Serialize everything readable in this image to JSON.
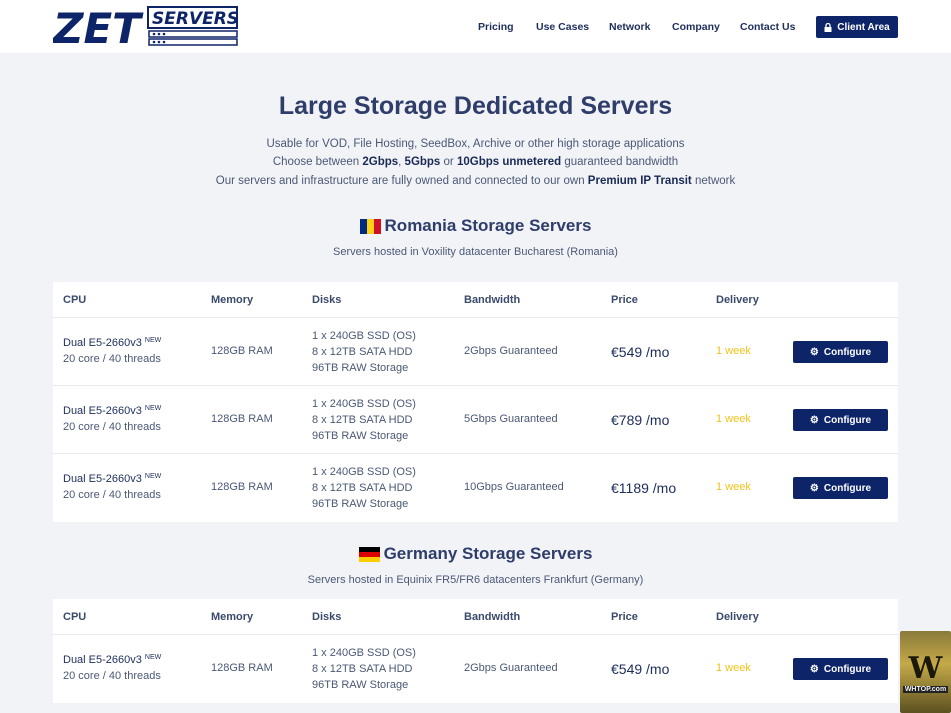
{
  "brand": {
    "name_main": "ZET",
    "name_sub": "SERVERS",
    "primary_color": "#0e2469",
    "accent_yellow": "#f0c419"
  },
  "nav": {
    "items": [
      "Pricing",
      "Use Cases",
      "Network",
      "Company",
      "Contact Us"
    ],
    "client_area": "Client Area"
  },
  "hero": {
    "title": "Large Storage Dedicated Servers",
    "line1": "Usable for VOD, File Hosting, SeedBox, Archive or other high storage applications",
    "line2_pre": "Choose between ",
    "line2_b1": "2Gbps",
    "line2_sep1": ", ",
    "line2_b2": "5Gbps",
    "line2_sep2": " or ",
    "line2_b3": "10Gbps unmetered",
    "line2_post": " guaranteed bandwidth",
    "line3_pre": "Our servers and infrastructure are fully owned and connected to our own ",
    "line3_b": "Premium IP Transit",
    "line3_post": " network"
  },
  "headers": {
    "cpu": "CPU",
    "memory": "Memory",
    "disks": "Disks",
    "bandwidth": "Bandwidth",
    "price": "Price",
    "delivery": "Delivery"
  },
  "sections": [
    {
      "title": "Romania Storage Servers",
      "subtitle": "Servers hosted in Voxility datacenter Bucharest (Romania)",
      "rows": [
        {
          "cpu": "Dual E5-2660v3",
          "tag": "NEW",
          "cores": "20 core / 40 threads",
          "memory": "128GB RAM",
          "disk1": "1 x 240GB SSD (OS)",
          "disk2": "8 x 12TB SATA HDD",
          "disk3": "96TB RAW Storage",
          "bandwidth": "2Gbps Guaranteed",
          "price": "€549 /mo",
          "delivery": "1 week",
          "button": "Configure"
        },
        {
          "cpu": "Dual E5-2660v3",
          "tag": "NEW",
          "cores": "20 core / 40 threads",
          "memory": "128GB RAM",
          "disk1": "1 x 240GB SSD (OS)",
          "disk2": "8 x 12TB SATA HDD",
          "disk3": "96TB RAW Storage",
          "bandwidth": "5Gbps Guaranteed",
          "price": "€789 /mo",
          "delivery": "1 week",
          "button": "Configure"
        },
        {
          "cpu": "Dual E5-2660v3",
          "tag": "NEW",
          "cores": "20 core / 40 threads",
          "memory": "128GB RAM",
          "disk1": "1 x 240GB SSD (OS)",
          "disk2": "8 x 12TB SATA HDD",
          "disk3": "96TB RAW Storage",
          "bandwidth": "10Gbps Guaranteed",
          "price": "€1189 /mo",
          "delivery": "1 week",
          "button": "Configure"
        }
      ]
    },
    {
      "title": "Germany Storage Servers",
      "subtitle": "Servers hosted in Equinix FR5/FR6 datacenters Frankfurt (Germany)",
      "rows": [
        {
          "cpu": "Dual E5-2660v3",
          "tag": "NEW",
          "cores": "20 core / 40 threads",
          "memory": "128GB RAM",
          "disk1": "1 x 240GB SSD (OS)",
          "disk2": "8 x 12TB SATA HDD",
          "disk3": "96TB RAW Storage",
          "bandwidth": "2Gbps Guaranteed",
          "price": "€549 /mo",
          "delivery": "1 week",
          "button": "Configure"
        }
      ]
    }
  ],
  "watermark": {
    "mark": "W",
    "text": "WHTOP.com"
  }
}
